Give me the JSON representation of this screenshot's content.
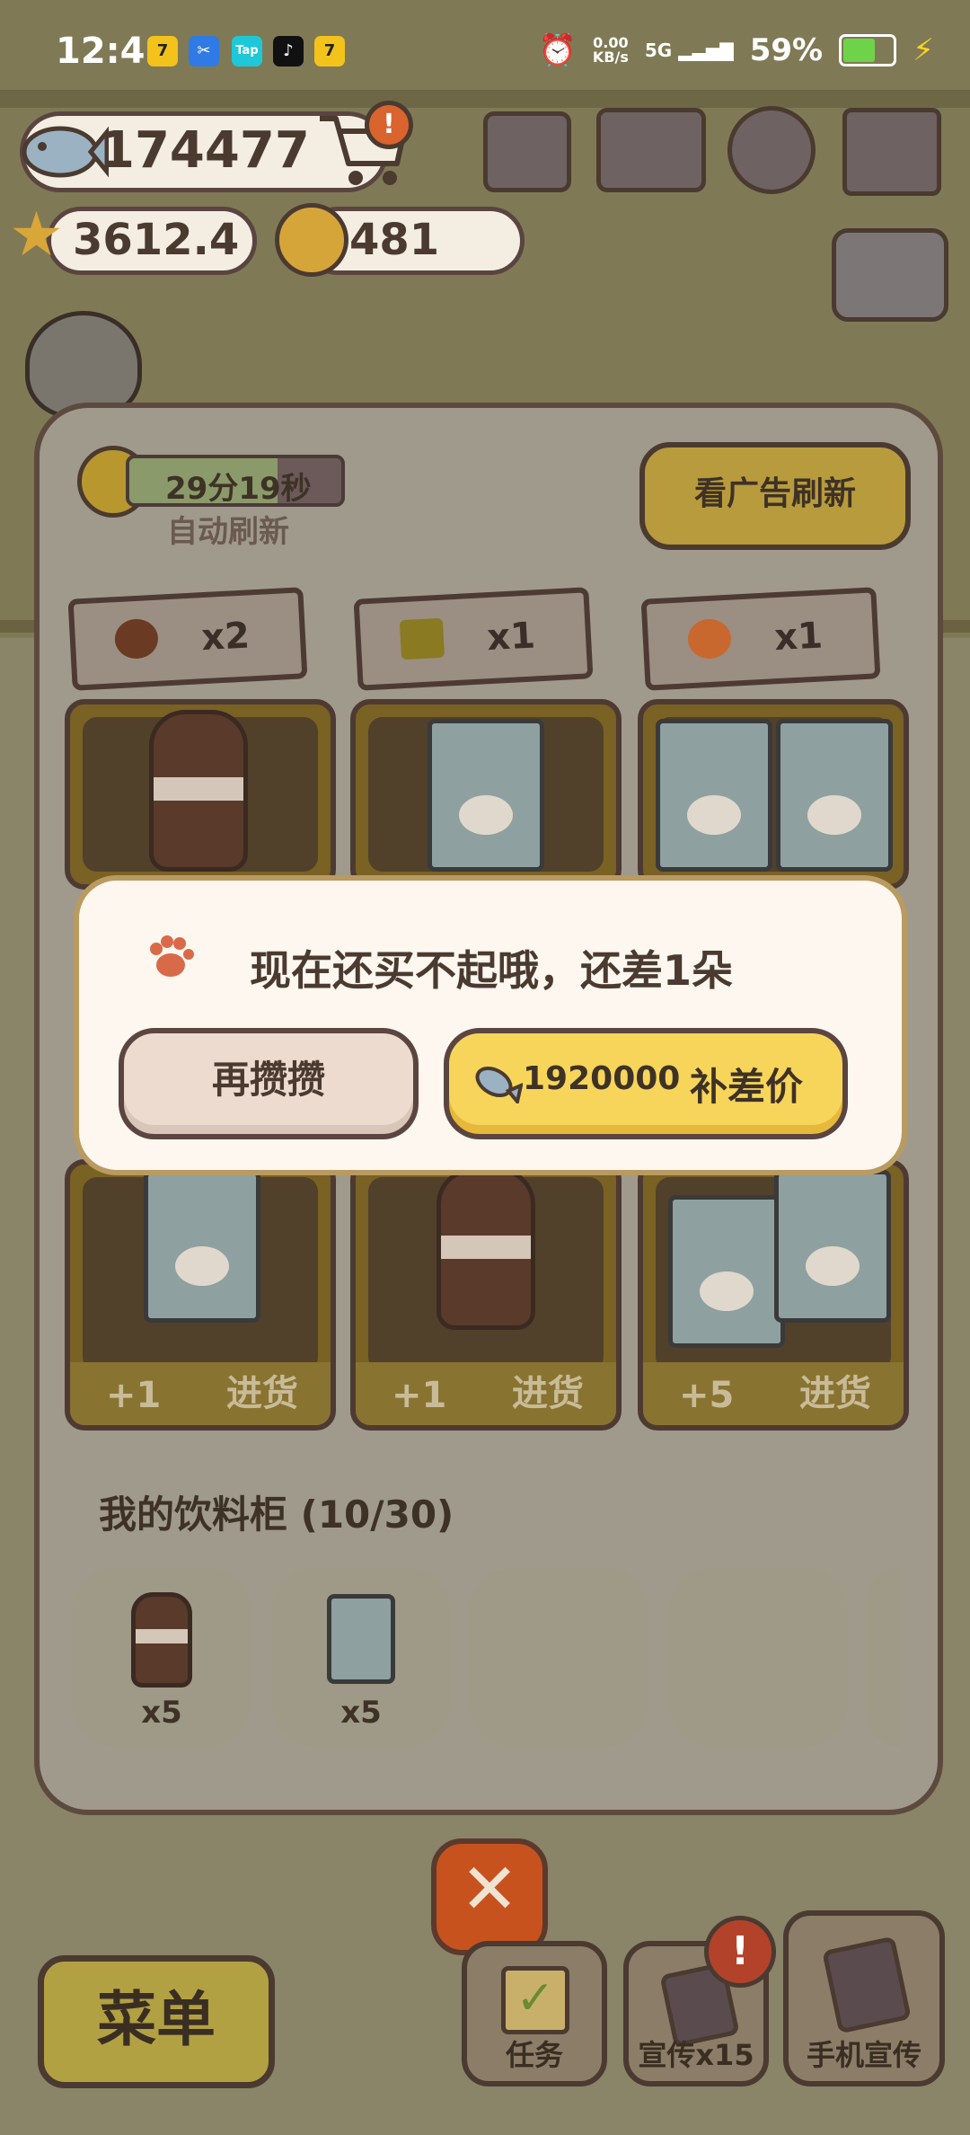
{
  "status_bar": {
    "time": "12:48",
    "net_speed_top": "0.00",
    "net_speed_bottom": "KB/s",
    "network": "5G",
    "battery": "59%"
  },
  "currency": {
    "fish": "174477",
    "stars": "3612.4",
    "bells": "481"
  },
  "refresh": {
    "timer": "29分19秒",
    "auto_label": "自动刷新",
    "ad_button": "看广告刷新"
  },
  "shelves": [
    {
      "requirement_qty": "x2",
      "restock_plus": "+1",
      "restock_label": "进货"
    },
    {
      "requirement_qty": "x1",
      "restock_plus": "+1",
      "restock_label": "进货"
    },
    {
      "requirement_qty": "x1",
      "restock_plus": "+5",
      "restock_label": "进货"
    }
  ],
  "cabinet": {
    "title": "我的饮料柜 (10/30)",
    "slots": [
      {
        "count": "x5"
      },
      {
        "count": "x5"
      }
    ]
  },
  "dialog": {
    "message": "现在还买不起哦，还差1朵",
    "save_button": "再攒攒",
    "pay_amount": "1920000",
    "pay_label": "补差价"
  },
  "bottom_bar": {
    "menu": "菜单",
    "tasks": "任务",
    "promote": "宣传x15",
    "phone_promote": "手机宣传"
  },
  "colors": {
    "accent_yellow": "#f7d55a",
    "close_orange": "#c8521e",
    "dialog_bg": "#fdf7ef"
  }
}
